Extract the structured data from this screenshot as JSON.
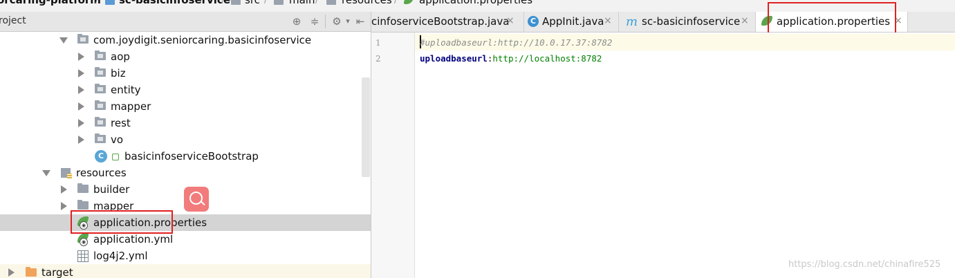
{
  "breadcrumbs": [
    "orcaring-platform",
    "sc-basicinfoservice",
    "src",
    "main",
    "resources",
    "application.properties"
  ],
  "project_panel": {
    "title": "roject"
  },
  "tree": [
    {
      "label": "com.joydigit.seniorcaring.basicinfoservice",
      "icon": "package-folder-icon",
      "expanded": true
    },
    {
      "label": "aop",
      "icon": "package-folder-icon"
    },
    {
      "label": "biz",
      "icon": "package-folder-icon"
    },
    {
      "label": "entity",
      "icon": "package-folder-icon"
    },
    {
      "label": "mapper",
      "icon": "package-folder-icon"
    },
    {
      "label": "rest",
      "icon": "package-folder-icon"
    },
    {
      "label": "vo",
      "icon": "package-folder-icon"
    },
    {
      "label": "basicinfoserviceBootstrap",
      "icon": "spring-boot-class-icon"
    },
    {
      "label": "resources",
      "icon": "resources-folder-icon",
      "expanded": true
    },
    {
      "label": "builder",
      "icon": "folder-icon"
    },
    {
      "label": "mapper",
      "icon": "folder-icon"
    },
    {
      "label": "application.properties",
      "icon": "spring-properties-icon",
      "selected": true
    },
    {
      "label": "application.yml",
      "icon": "spring-yml-icon"
    },
    {
      "label": "log4j2.yml",
      "icon": "grid-file-icon"
    },
    {
      "label": "target",
      "icon": "excluded-folder-icon"
    }
  ],
  "tabs": [
    {
      "label": "cinfoserviceBootstrap.java"
    },
    {
      "label": "AppInit.java"
    },
    {
      "label": "sc-basicinfoservice"
    },
    {
      "label": "application.properties",
      "active": true
    }
  ],
  "tab_close_glyph": "×",
  "editor": {
    "line_numbers": [
      "1",
      "2"
    ],
    "line1_comment": "#uploadbaseurl:http://10.0.17.37:8782",
    "line2_key": "uploadbaseurl",
    "line2_sep": ":",
    "line2_value": "http://localhost:8782"
  },
  "watermark": "https://blog.csdn.net/chinafire525",
  "colors": {
    "highlight_box": "#e02020",
    "selection": "#d4d4d4",
    "string_value": "#008000",
    "property_key": "#000080"
  }
}
